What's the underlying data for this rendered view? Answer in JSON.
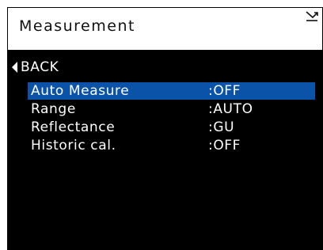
{
  "header": {
    "title": "Measurement"
  },
  "nav": {
    "back_label": "BACK"
  },
  "menu": {
    "items": [
      {
        "label": "Auto Measure",
        "value": ":OFF",
        "selected": true
      },
      {
        "label": "Range",
        "value": ":AUTO",
        "selected": false
      },
      {
        "label": "Reflectance",
        "value": ":GU",
        "selected": false
      },
      {
        "label": "Historic cal.",
        "value": ":OFF",
        "selected": false
      }
    ]
  },
  "colors": {
    "background": "#000000",
    "header_background": "#ffffff",
    "selection": "#0a53a8",
    "text": "#ffffff"
  },
  "icons": {
    "header": "send-to-icon"
  }
}
